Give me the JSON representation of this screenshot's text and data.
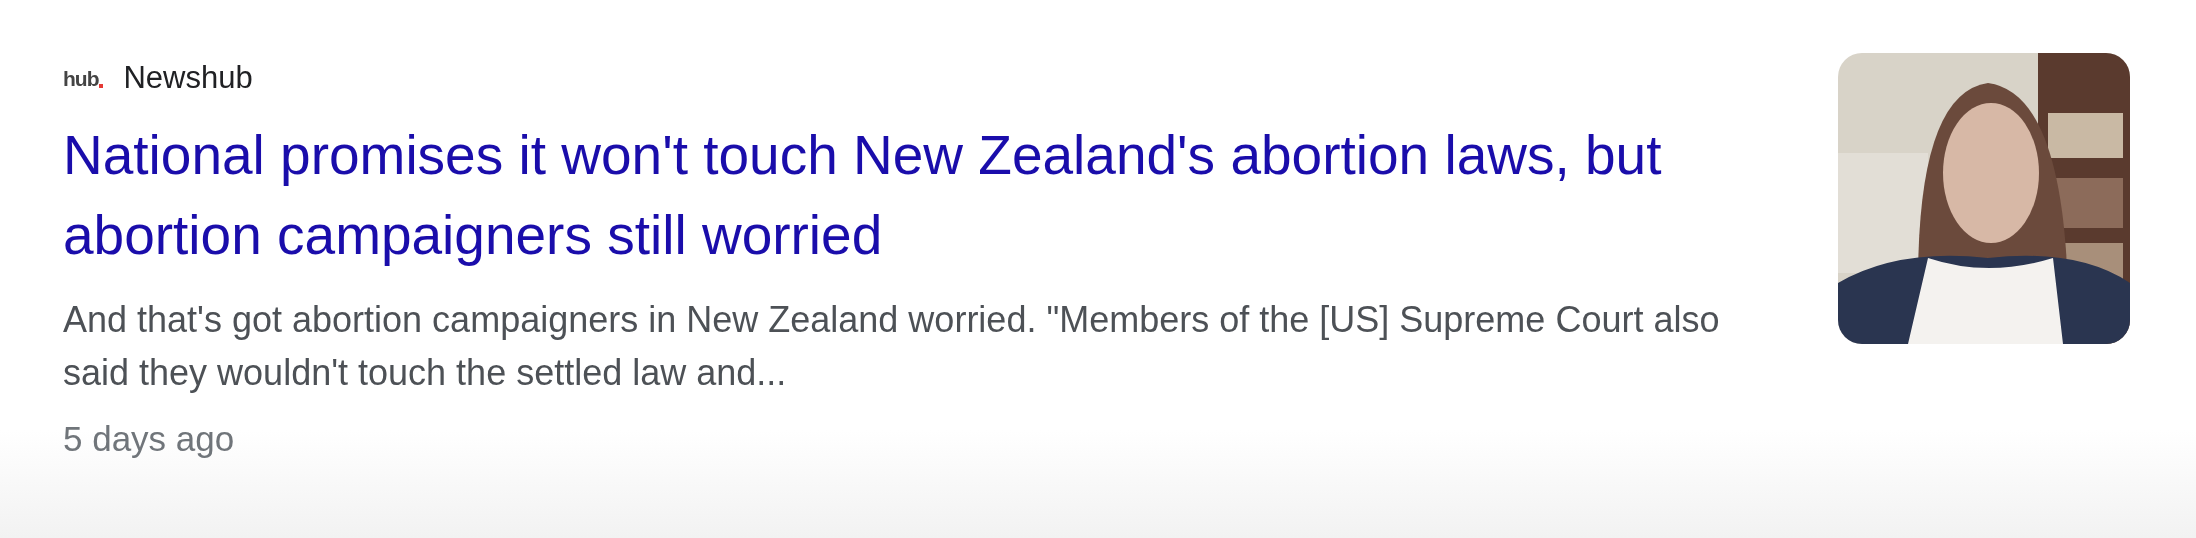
{
  "source": {
    "logo": "hub",
    "name": "Newshub"
  },
  "headline": "National promises it won't touch New Zealand's abortion laws, but abortion campaigners still worried",
  "snippet": "And that's got abortion campaigners in New Zealand worried. \"Members of the [US] Supreme Court also said they wouldn't touch the settled law and...",
  "age": "5 days ago"
}
